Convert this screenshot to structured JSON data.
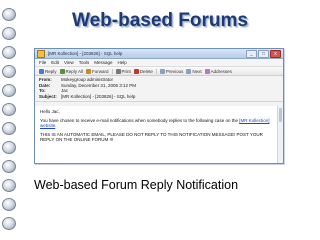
{
  "slide": {
    "title": "Web-based Forums",
    "caption": "Web-based Forum Reply Notification"
  },
  "window": {
    "title": "[MR Kollection] - [203826] - SQL help",
    "controls": [
      "_",
      "□",
      "X"
    ],
    "menu": [
      "File",
      "Edit",
      "View",
      "Tools",
      "Message",
      "Help"
    ],
    "toolbar": [
      {
        "label": "Reply",
        "icon": "reply-icon"
      },
      {
        "label": "Reply All",
        "icon": "reply-all-icon"
      },
      {
        "label": "Forward",
        "icon": "forward-icon"
      },
      {
        "label": "Print",
        "icon": "print-icon"
      },
      {
        "label": "Delete",
        "icon": "delete-icon"
      },
      {
        "label": "Previous",
        "icon": "previous-icon"
      },
      {
        "label": "Next",
        "icon": "next-icon"
      },
      {
        "label": "Addresses",
        "icon": "addresses-icon"
      }
    ],
    "headers": {
      "from_label": "From:",
      "from_value": "Mokeygroup administrator",
      "date_label": "Date:",
      "date_value": "Sunday, December 31, 2006 3:12 PM",
      "to_label": "To:",
      "to_value": "Jac",
      "subject_label": "Subject:",
      "subject_value": "[MR Kollection] - [203826] - SQL help"
    },
    "body": {
      "greeting": "Hello Jac,",
      "para1": "You have chosen to receive e-mail notifications when somebody replies to the following case on the",
      "para1_link": "[MR Kollection] website",
      "para1_end": ".",
      "para2": "THIS IS AN AUTOMATIC EMAIL, PLEASE DO NOT REPLY TO THIS NOTIFICATION MESSAGE! POST YOUR REPLY ON THE ONLINE FORUM !!!"
    }
  }
}
